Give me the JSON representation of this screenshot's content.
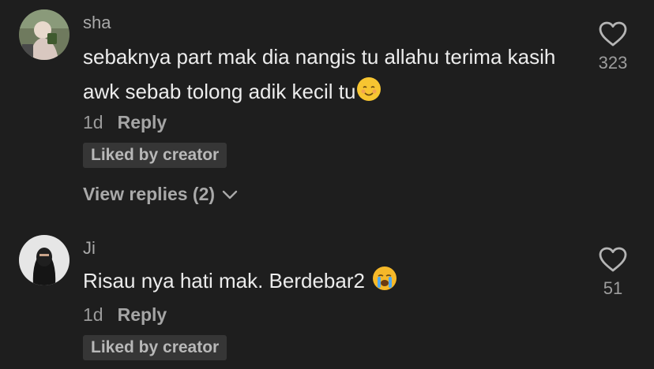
{
  "comments": [
    {
      "username": "sha",
      "text": "sebaknya part mak dia nangis tu allahu terima kasih awk sebab tolong adik kecil tu",
      "emoji": "smiling-face-icon",
      "time": "1d",
      "reply_label": "Reply",
      "badge": "Liked by creator",
      "view_replies": "View replies (2)",
      "likes": "323"
    },
    {
      "username": "Ji",
      "text": "Risau nya hati mak. Berdebar2",
      "emoji": "loudly-crying-face-icon",
      "time": "1d",
      "reply_label": "Reply",
      "badge": "Liked by creator",
      "likes": "51"
    }
  ],
  "colors": {
    "background": "#1e1e1e",
    "text_primary": "#ececec",
    "text_secondary": "#a9a9a9",
    "badge_bg": "#363636"
  }
}
